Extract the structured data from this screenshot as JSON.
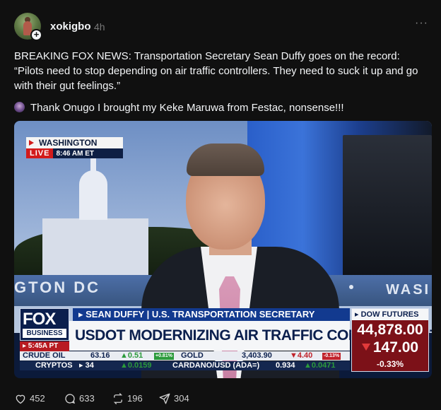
{
  "post": {
    "username": "xokigbo",
    "time": "4h",
    "more_label": "···",
    "text": "BREAKING FOX NEWS: Transportation Secretary Sean Duffy goes on the record: “Pilots need to stop depending on air traffic controllers. They need to suck it up and go with their gut feelings.”",
    "text2": "Thank Onugo I brought my Keke Maruwa from Festac, nonsense!!!",
    "follow_icon": "plus-icon"
  },
  "broadcast": {
    "location": "WASHINGTON",
    "live": "LIVE",
    "live_time": "8:46 AM ET",
    "backdrop_left": "GTON DC",
    "backdrop_right": "WASI",
    "logo_top": "FOX",
    "logo_bottom": "BUSINESS",
    "clock": "▸ 5:45A PT",
    "name_bar": "▸ SEAN DUFFY | U.S. TRANSPORTATION SECRETARY",
    "headline": "USDOT MODERNIZING AIR TRAFFIC CONTROL SYSTEMS",
    "dow_label": "▸ DOW FUTURES",
    "dow_value": "44,878.00",
    "dow_change": "147.00",
    "dow_pct": "-0.33%",
    "ticker1": {
      "crude_label": "CRUDE OIL",
      "crude_value": "63.16",
      "crude_change": "▲0.51",
      "crude_pct": "+0.81%",
      "gold_label": "GOLD",
      "gold_value": "3,403.90",
      "gold_change": "▼4.40",
      "gold_pct": "-0.13%"
    },
    "ticker2": {
      "crypto_label": "CRYPTOS",
      "crypto_fragment": "▸ 34",
      "crypto_change": "▲0.0159",
      "cardano_label": "CARDANO/USD (ADA=)",
      "cardano_value": "0.934",
      "cardano_change": "▲0.0471"
    }
  },
  "actions": {
    "likes": "452",
    "replies": "633",
    "reposts": "196",
    "shares": "304"
  },
  "colors": {
    "background": "#101010",
    "text": "#f3f5f7",
    "muted": "#777777",
    "fox_navy": "#0b1f4d",
    "fox_red": "#b81b22"
  }
}
